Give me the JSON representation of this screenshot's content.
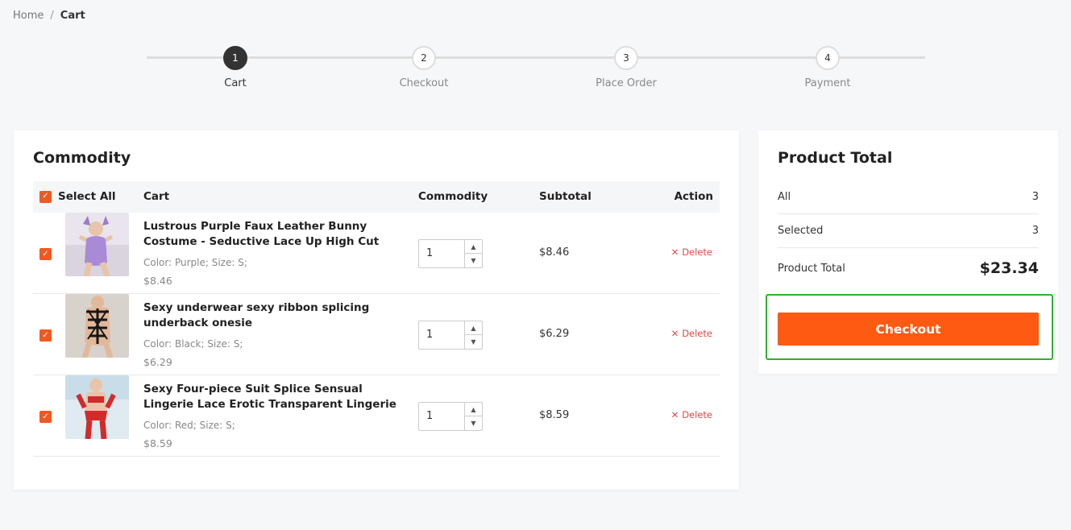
{
  "breadcrumb": {
    "home": "Home",
    "separator": "/",
    "current": "Cart"
  },
  "steps": [
    {
      "number": "1",
      "label": "Cart",
      "active": true
    },
    {
      "number": "2",
      "label": "Checkout",
      "active": false
    },
    {
      "number": "3",
      "label": "Place Order",
      "active": false
    },
    {
      "number": "4",
      "label": "Payment",
      "active": false
    }
  ],
  "commodity": {
    "title": "Commodity",
    "headers": {
      "select_all": "Select All",
      "cart": "Cart",
      "commodity": "Commodity",
      "subtotal": "Subtotal",
      "action": "Action"
    },
    "items": [
      {
        "title": "Lustrous Purple Faux Leather Bunny Costume - Seductive Lace Up High Cut Bodysuit with...",
        "variant": "Color: Purple; Size: S;",
        "price": "$8.46",
        "quantity": "1",
        "subtotal": "$8.46",
        "delete": "Delete",
        "checked": true,
        "thumb_color": "#b39ad6"
      },
      {
        "title": "Sexy underwear sexy ribbon splicing underback onesie",
        "variant": "Color: Black; Size: S;",
        "price": "$6.29",
        "quantity": "1",
        "subtotal": "$6.29",
        "delete": "Delete",
        "checked": true,
        "thumb_color": "#2a2a2a"
      },
      {
        "title": "Sexy Four-piece Suit Splice Sensual Lingerie Lace Erotic Transparent Lingerie Womens Sexy...",
        "variant": "Color: Red; Size: S;",
        "price": "$8.59",
        "quantity": "1",
        "subtotal": "$8.59",
        "delete": "Delete",
        "checked": true,
        "thumb_color": "#d42a2a"
      }
    ]
  },
  "summary": {
    "title": "Product Total",
    "all_label": "All",
    "all_value": "3",
    "selected_label": "Selected",
    "selected_value": "3",
    "total_label": "Product Total",
    "total_value": "$23.34",
    "checkout_label": "Checkout"
  },
  "colors": {
    "accent": "#fe5a12",
    "checkbox": "#f05a22",
    "delete": "#e04848",
    "highlight": "#2db22d"
  }
}
